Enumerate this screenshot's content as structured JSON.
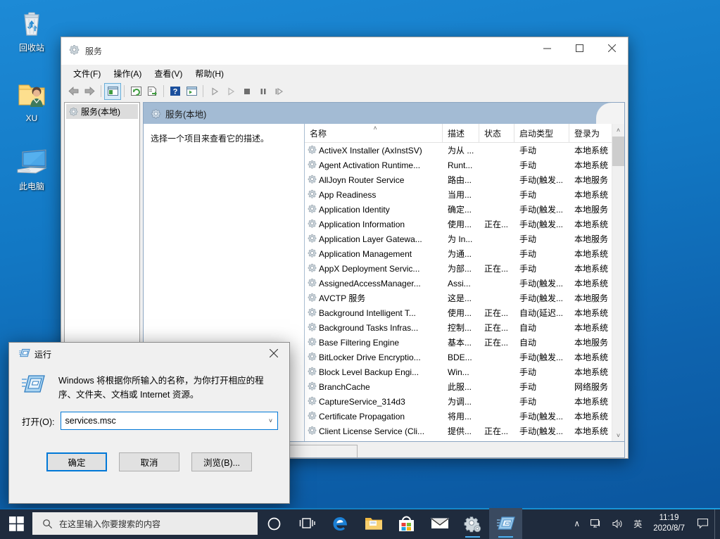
{
  "desktop": {
    "icons": [
      {
        "name": "recycle-bin",
        "label": "回收站"
      },
      {
        "name": "user-folder",
        "label": "XU"
      },
      {
        "name": "this-pc",
        "label": "此电脑"
      }
    ]
  },
  "services_window": {
    "title": "服务",
    "title_icon": "services-gear-icon",
    "caption": {
      "minimize": "–",
      "maximize": "☐",
      "close": "✕"
    },
    "menus": [
      "文件(F)",
      "操作(A)",
      "查看(V)",
      "帮助(H)"
    ],
    "toolbar": [
      {
        "name": "back-icon",
        "glyph": "back"
      },
      {
        "name": "forward-icon",
        "glyph": "forward"
      },
      {
        "name": "show-hide-tree-icon",
        "glyph": "tree",
        "pressed": true
      },
      {
        "name": "refresh-icon",
        "glyph": "refresh"
      },
      {
        "name": "export-list-icon",
        "glyph": "export"
      },
      {
        "name": "help-icon",
        "glyph": "help"
      },
      {
        "name": "properties-icon",
        "glyph": "props"
      },
      {
        "name": "start-service-icon",
        "glyph": "play"
      },
      {
        "name": "resume-service-icon",
        "glyph": "play2"
      },
      {
        "name": "stop-service-icon",
        "glyph": "stop"
      },
      {
        "name": "pause-service-icon",
        "glyph": "pause"
      },
      {
        "name": "restart-service-icon",
        "glyph": "restart"
      }
    ],
    "tree": {
      "root_label": "服务(本地)"
    },
    "band_title": "服务(本地)",
    "description_pane": "选择一个项目来查看它的描述。",
    "columns": [
      {
        "key": "name",
        "label": "名称",
        "sorted": true,
        "sort_caret": "˄"
      },
      {
        "key": "desc",
        "label": "描述"
      },
      {
        "key": "state",
        "label": "状态"
      },
      {
        "key": "start",
        "label": "启动类型"
      },
      {
        "key": "logon",
        "label": "登录为"
      }
    ],
    "rows": [
      {
        "name": "ActiveX Installer (AxInstSV)",
        "desc": "为从 ...",
        "state": "",
        "start": "手动",
        "logon": "本地系统"
      },
      {
        "name": "Agent Activation Runtime...",
        "desc": "Runt...",
        "state": "",
        "start": "手动",
        "logon": "本地系统"
      },
      {
        "name": "AllJoyn Router Service",
        "desc": "路由...",
        "state": "",
        "start": "手动(触发...",
        "logon": "本地服务"
      },
      {
        "name": "App Readiness",
        "desc": "当用...",
        "state": "",
        "start": "手动",
        "logon": "本地系统"
      },
      {
        "name": "Application Identity",
        "desc": "确定...",
        "state": "",
        "start": "手动(触发...",
        "logon": "本地服务"
      },
      {
        "name": "Application Information",
        "desc": "使用...",
        "state": "正在...",
        "start": "手动(触发...",
        "logon": "本地系统"
      },
      {
        "name": "Application Layer Gatewa...",
        "desc": "为 In...",
        "state": "",
        "start": "手动",
        "logon": "本地服务"
      },
      {
        "name": "Application Management",
        "desc": "为通...",
        "state": "",
        "start": "手动",
        "logon": "本地系统"
      },
      {
        "name": "AppX Deployment Servic...",
        "desc": "为部...",
        "state": "正在...",
        "start": "手动",
        "logon": "本地系统"
      },
      {
        "name": "AssignedAccessManager...",
        "desc": "Assi...",
        "state": "",
        "start": "手动(触发...",
        "logon": "本地系统"
      },
      {
        "name": "AVCTP 服务",
        "desc": "这是...",
        "state": "",
        "start": "手动(触发...",
        "logon": "本地服务"
      },
      {
        "name": "Background Intelligent T...",
        "desc": "使用...",
        "state": "正在...",
        "start": "自动(延迟...",
        "logon": "本地系统"
      },
      {
        "name": "Background Tasks Infras...",
        "desc": "控制...",
        "state": "正在...",
        "start": "自动",
        "logon": "本地系统"
      },
      {
        "name": "Base Filtering Engine",
        "desc": "基本...",
        "state": "正在...",
        "start": "自动",
        "logon": "本地服务"
      },
      {
        "name": "BitLocker Drive Encryptio...",
        "desc": "BDE...",
        "state": "",
        "start": "手动(触发...",
        "logon": "本地系统"
      },
      {
        "name": "Block Level Backup Engi...",
        "desc": "Win...",
        "state": "",
        "start": "手动",
        "logon": "本地系统"
      },
      {
        "name": "BranchCache",
        "desc": "此服...",
        "state": "",
        "start": "手动",
        "logon": "网络服务"
      },
      {
        "name": "CaptureService_314d3",
        "desc": "为调...",
        "state": "",
        "start": "手动",
        "logon": "本地系统"
      },
      {
        "name": "Certificate Propagation",
        "desc": "将用...",
        "state": "",
        "start": "手动(触发...",
        "logon": "本地系统"
      },
      {
        "name": "Client License Service (Cli...",
        "desc": "提供...",
        "state": "正在...",
        "start": "手动(触发...",
        "logon": "本地系统"
      }
    ],
    "tabs": [
      {
        "label": ""
      },
      {
        "label": ""
      }
    ],
    "scrollbar": {
      "up": "˄",
      "down": "˅"
    }
  },
  "run_dialog": {
    "title": "运行",
    "title_icon": "run-window-icon",
    "close_label": "✕",
    "description": "Windows 将根据你所输入的名称，为你打开相应的程序、文件夹、文档或 Internet 资源。",
    "open_label": "打开(O):",
    "input_value": "services.msc",
    "input_placeholder": "",
    "combo_arrow": "˅",
    "buttons": [
      {
        "name": "ok-button",
        "label": "确定",
        "default": true
      },
      {
        "name": "cancel-button",
        "label": "取消",
        "default": false
      },
      {
        "name": "browse-button",
        "label": "浏览(B)...",
        "default": false
      }
    ]
  },
  "taskbar": {
    "start_icon": "windows-start-icon",
    "search": {
      "icon": "search-icon",
      "placeholder": "在这里输入你要搜索的内容"
    },
    "items": [
      {
        "name": "cortana-icon",
        "glyph": "cortana",
        "active": false,
        "running": false
      },
      {
        "name": "task-view-icon",
        "glyph": "taskview",
        "active": false,
        "running": false
      },
      {
        "name": "edge-icon",
        "glyph": "edge",
        "active": false,
        "running": false
      },
      {
        "name": "file-explorer-icon",
        "glyph": "folder",
        "active": false,
        "running": false
      },
      {
        "name": "microsoft-store-icon",
        "glyph": "store",
        "active": false,
        "running": false
      },
      {
        "name": "mail-icon",
        "glyph": "mail",
        "active": false,
        "running": false
      },
      {
        "name": "services-taskbar-icon",
        "glyph": "gear",
        "active": false,
        "running": true
      },
      {
        "name": "run-dialog-taskbar-icon",
        "glyph": "run",
        "active": true,
        "running": true
      }
    ],
    "tray": [
      {
        "name": "show-hidden-icons",
        "glyph": "∧"
      },
      {
        "name": "network-icon",
        "glyph": "network"
      },
      {
        "name": "volume-icon",
        "glyph": "volume"
      },
      {
        "name": "ime-indicator",
        "glyph": "英"
      }
    ],
    "clock": {
      "time": "11:19",
      "date": "2020/8/7"
    },
    "action_center_icon": "notification-icon"
  },
  "colors": {
    "accent": "#0078d7",
    "taskbar": "#1f2b3d",
    "band": "#a3bbd4",
    "desktop_top": "#1d8ad6"
  }
}
